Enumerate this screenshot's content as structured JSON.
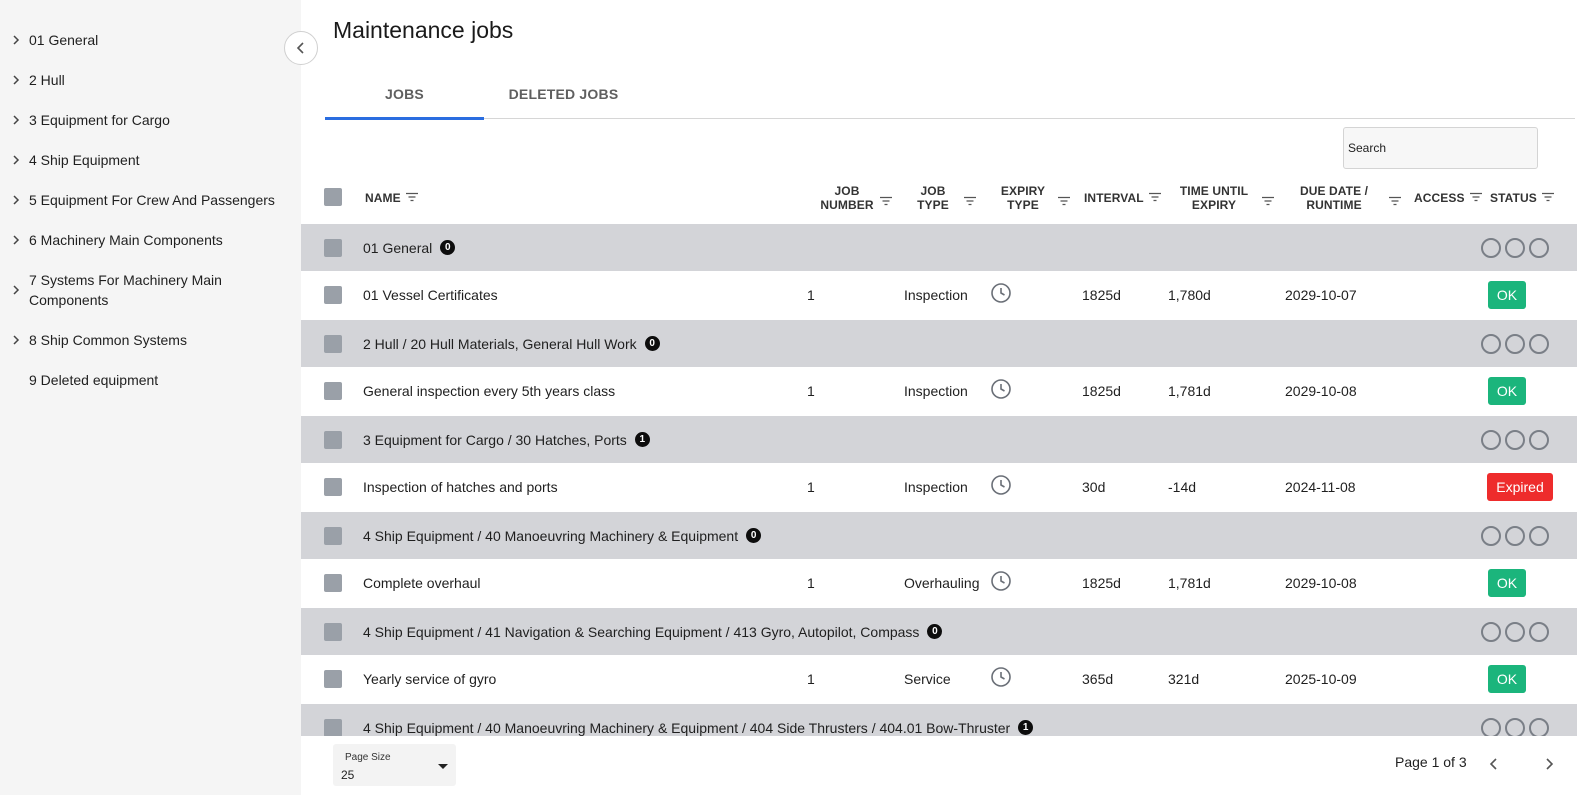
{
  "sidebar": {
    "items": [
      {
        "label": "01 General",
        "expandable": true
      },
      {
        "label": "2 Hull",
        "expandable": true
      },
      {
        "label": "3 Equipment for Cargo",
        "expandable": true
      },
      {
        "label": "4 Ship Equipment",
        "expandable": true
      },
      {
        "label": "5 Equipment For Crew And Passengers",
        "expandable": true
      },
      {
        "label": "6 Machinery Main Components",
        "expandable": true
      },
      {
        "label": "7 Systems For Machinery Main Components",
        "expandable": true
      },
      {
        "label": "8 Ship Common Systems",
        "expandable": true
      },
      {
        "label": "9 Deleted equipment",
        "expandable": false
      }
    ],
    "collapse_icon": "chevron-left-icon"
  },
  "page": {
    "title": "Maintenance jobs"
  },
  "tabs": [
    {
      "label": "JOBS",
      "active": true
    },
    {
      "label": "DELETED JOBS",
      "active": false
    }
  ],
  "search": {
    "placeholder": "Search",
    "value": ""
  },
  "columns": {
    "name": "NAME",
    "job_number": "JOB NUMBER",
    "job_type": "JOB TYPE",
    "expiry_type": "EXPIRY TYPE",
    "interval": "INTERVAL",
    "time_until_expiry": "TIME UNTIL EXPIRY",
    "due_date": "DUE DATE / RUNTIME",
    "access": "ACCESS",
    "status": "STATUS"
  },
  "rows": [
    {
      "kind": "group",
      "name": "01 General",
      "count": "0"
    },
    {
      "kind": "job",
      "name": "01 Vessel Certificates",
      "job_number": "1",
      "job_type": "Inspection",
      "expiry_icon": "clock-icon",
      "interval": "1825d",
      "time_until_expiry": "1,780d",
      "due_date": "2029-10-07",
      "status": "OK"
    },
    {
      "kind": "group",
      "name": "2 Hull / 20 Hull Materials, General Hull Work",
      "count": "0"
    },
    {
      "kind": "job",
      "name": "General inspection every 5th years class",
      "job_number": "1",
      "job_type": "Inspection",
      "expiry_icon": "clock-icon",
      "interval": "1825d",
      "time_until_expiry": "1,781d",
      "due_date": "2029-10-08",
      "status": "OK"
    },
    {
      "kind": "group",
      "name": "3 Equipment for Cargo / 30 Hatches, Ports",
      "count": "1"
    },
    {
      "kind": "job",
      "name": "Inspection of hatches and ports",
      "job_number": "1",
      "job_type": "Inspection",
      "expiry_icon": "clock-icon",
      "interval": "30d",
      "time_until_expiry": "-14d",
      "due_date": "2024-11-08",
      "status": "Expired"
    },
    {
      "kind": "group",
      "name": "4 Ship Equipment / 40 Manoeuvring Machinery & Equipment",
      "count": "0"
    },
    {
      "kind": "job",
      "name": "Complete overhaul",
      "job_number": "1",
      "job_type": "Overhauling",
      "expiry_icon": "clock-icon",
      "interval": "1825d",
      "time_until_expiry": "1,781d",
      "due_date": "2029-10-08",
      "status": "OK"
    },
    {
      "kind": "group",
      "name": "4 Ship Equipment / 41 Navigation & Searching Equipment / 413 Gyro, Autopilot, Compass",
      "count": "0"
    },
    {
      "kind": "job",
      "name": "Yearly service of gyro",
      "job_number": "1",
      "job_type": "Service",
      "expiry_icon": "clock-icon",
      "interval": "365d",
      "time_until_expiry": "321d",
      "due_date": "2025-10-09",
      "status": "OK"
    },
    {
      "kind": "group",
      "name": "4 Ship Equipment / 40 Manoeuvring Machinery & Equipment / 404 Side Thrusters / 404.01 Bow-Thruster",
      "count": "1"
    }
  ],
  "colors": {
    "accent": "#2a6de0",
    "ok": "#1bb57c",
    "expired": "#ee2c2c",
    "group_row": "#d3d4d8",
    "sidebar_bg": "#f5f5f5"
  },
  "footer": {
    "page_size_label": "Page Size",
    "page_size_value": "25",
    "page_info": "Page 1 of 3"
  }
}
